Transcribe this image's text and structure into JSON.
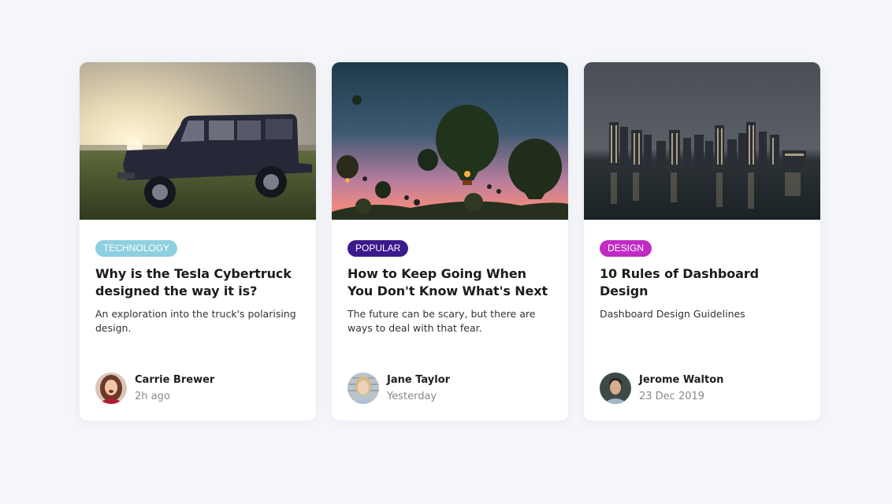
{
  "cards": [
    {
      "tag": "TECHNOLOGY",
      "tag_color": "#8ecfe0",
      "title": "Why is the Tesla Cybertruck designed the way it is?",
      "description": "An exploration into the truck's polarising design.",
      "author": "Carrie Brewer",
      "date": "2h ago"
    },
    {
      "tag": "POPULAR",
      "tag_color": "#3b1a8c",
      "title": "How to Keep Going When You Don't Know What's Next",
      "description": "The future can be scary, but there are ways to deal with that fear.",
      "author": "Jane Taylor",
      "date": "Yesterday"
    },
    {
      "tag": "DESIGN",
      "tag_color": "#c02bc4",
      "title": "10 Rules of Dashboard Design",
      "description": "Dashboard Design Guidelines",
      "author": "Jerome Walton",
      "date": "23 Dec 2019"
    }
  ]
}
